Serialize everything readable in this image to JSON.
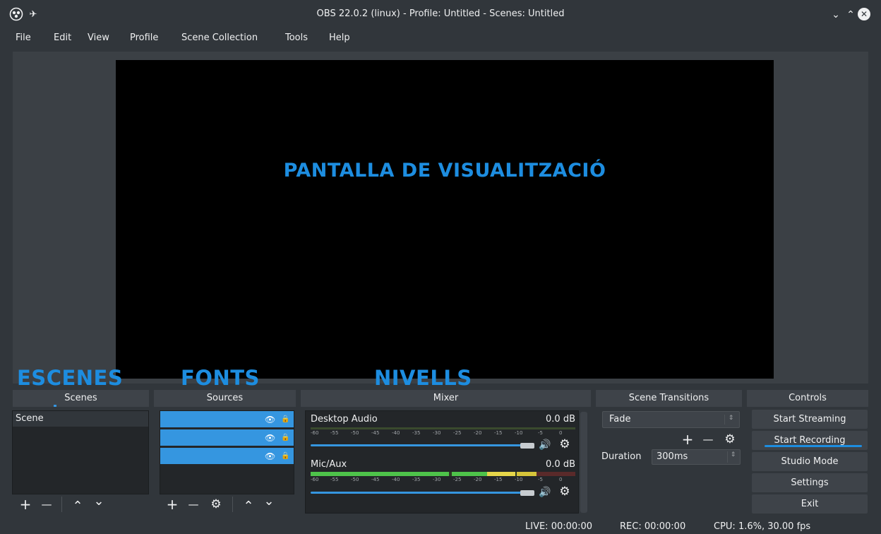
{
  "window": {
    "title": "OBS 22.0.2 (linux) - Profile: Untitled - Scenes: Untitled",
    "app_icon": "obs-logo-icon",
    "pin_icon": "pin-icon",
    "minimize_icon": "chevron-down-icon",
    "maximize_icon": "chevron-up-icon",
    "close_icon": "close-icon",
    "close_glyph": "✕"
  },
  "menu": {
    "items": [
      "File",
      "Edit",
      "View",
      "Profile",
      "Scene Collection",
      "Tools",
      "Help"
    ]
  },
  "preview": {
    "caption": "PANTALLA DE VISUALITZACIÓ"
  },
  "overlays": {
    "escenes": "ESCENES",
    "fonts": "FONTS",
    "nivells": "NIVELLS"
  },
  "docks": {
    "scenes": "Scenes",
    "sources": "Sources",
    "mixer": "Mixer",
    "transitions": "Scene Transitions",
    "controls": "Controls"
  },
  "scenes": {
    "items": [
      "Scene"
    ],
    "toolbar": {
      "add": "+",
      "remove": "—",
      "up": "⌃",
      "down": "⌄"
    }
  },
  "sources": {
    "rows": 3,
    "eye_glyph": "👁",
    "lock_glyph": "🔒",
    "toolbar": {
      "add": "+",
      "remove": "—",
      "settings": "⚙",
      "up": "⌃",
      "down": "⌄"
    }
  },
  "mixer": {
    "channels": [
      {
        "name": "Desktop Audio",
        "db": "0.0 dB",
        "volume": 1.0
      },
      {
        "name": "Mic/Aux",
        "db": "0.0 dB",
        "volume": 1.0
      }
    ],
    "ticks": [
      "-60",
      "-55",
      "-50",
      "-45",
      "-40",
      "-35",
      "-30",
      "-25",
      "-20",
      "-15",
      "-10",
      "-5",
      "0"
    ],
    "speaker_glyph": "🔊",
    "gear_glyph": "⚙"
  },
  "transitions": {
    "selected": "Fade",
    "add": "+",
    "remove": "—",
    "settings": "⚙",
    "duration_label": "Duration",
    "duration_value": "300ms"
  },
  "controls": {
    "start_streaming": "Start Streaming",
    "start_recording": "Start Recording",
    "studio_mode": "Studio Mode",
    "settings": "Settings",
    "exit": "Exit"
  },
  "status": {
    "live": "LIVE: 00:00:00",
    "rec": "REC: 00:00:00",
    "cpu": "CPU: 1.6%, 30.00 fps"
  },
  "colors": {
    "accent": "#3596e0",
    "annotation": "#1d8de0"
  }
}
